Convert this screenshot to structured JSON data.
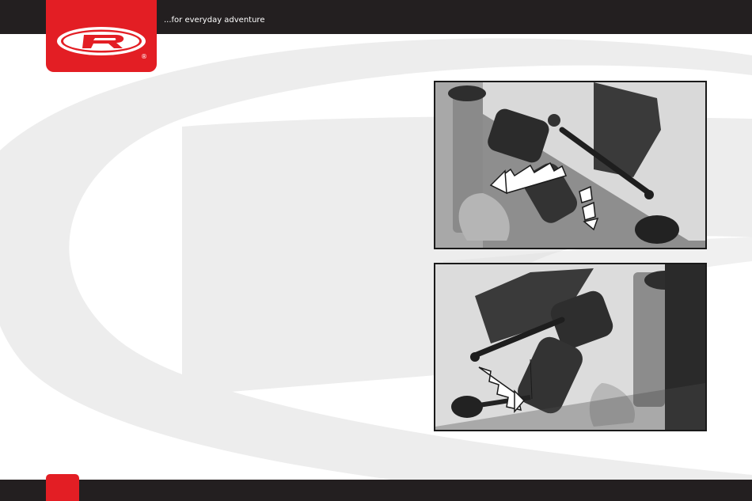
{
  "header": {
    "tagline": "...for everyday adventure",
    "logo": {
      "letter": "R",
      "mark": "®",
      "color": "#e31e24"
    }
  },
  "colors": {
    "brand_red": "#e31e24",
    "bar_dark": "#231f20",
    "watermark_gray": "#ededed"
  },
  "figures": [
    {
      "icon": "handlebar-throttle-open-photo"
    },
    {
      "icon": "handlebar-throttle-closed-photo"
    }
  ]
}
